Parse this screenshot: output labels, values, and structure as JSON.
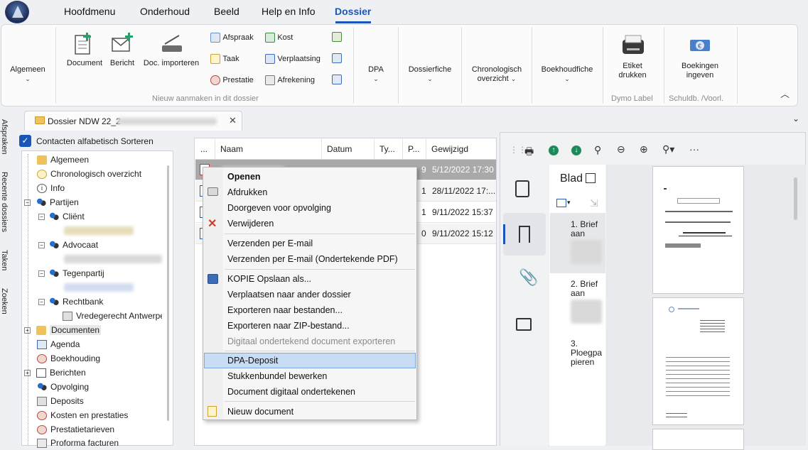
{
  "menubar": {
    "tabs": [
      "Hoofdmenu",
      "Onderhoud",
      "Beeld",
      "Help en Info",
      "Dossier"
    ],
    "active": "Dossier"
  },
  "ribbon": {
    "algemeen": "Algemeen",
    "document": "Document",
    "bericht": "Bericht",
    "doc_importeren": "Doc. importeren",
    "afspraak": "Afspraak",
    "taak": "Taak",
    "prestatie": "Prestatie",
    "kost": "Kost",
    "verplaatsing": "Verplaatsing",
    "afrekening": "Afrekening",
    "group_new": "Nieuw aanmaken in dit dossier",
    "dpa": "DPA",
    "dossierfiche": "Dossierfiche",
    "chrono_1": "Chronologisch",
    "chrono_2": "overzicht",
    "boekhoudfiche": "Boekhoudfiche",
    "etiket_1": "Etiket",
    "etiket_2": "drukken",
    "group_dymo": "Dymo Label",
    "boekingen_1": "Boekingen",
    "boekingen_2": "ingeven",
    "group_schuld": "Schuldb. /Voorl."
  },
  "doctab": {
    "title": "Dossier NDW 22_2 -"
  },
  "sidetabs": [
    "Afspraken",
    "Recente dossiers",
    "Taken",
    "Zoeken"
  ],
  "sort_label": "Contacten alfabetisch Sorteren",
  "tree": {
    "algemeen": "Algemeen",
    "chrono": "Chronologisch overzicht",
    "info": "Info",
    "partijen": "Partijen",
    "client": "Cliënt",
    "advocaat": "Advocaat",
    "tegenpartij": "Tegenpartij",
    "rechtbank": "Rechtbank",
    "vredegerecht": "Vredegerecht Antwerpen",
    "documenten": "Documenten",
    "agenda": "Agenda",
    "boekhouding": "Boekhouding",
    "berichten": "Berichten",
    "opvolging": "Opvolging",
    "deposits": "Deposits",
    "kosten": "Kosten en prestaties",
    "prestatietarieven": "Prestatietarieven",
    "proforma": "Proforma facturen"
  },
  "grid": {
    "headers": [
      "...",
      "Naam",
      "Datum",
      "Ty...",
      "P...",
      "Gewijzigd"
    ],
    "rows": [
      {
        "p": "9",
        "gewijzigd": "5/12/2022 17:30"
      },
      {
        "p": "1",
        "gewijzigd": "28/11/2022 17:..."
      },
      {
        "p": "1",
        "gewijzigd": "9/11/2022 15:37"
      },
      {
        "p": "0",
        "gewijzigd": "9/11/2022 15:12"
      }
    ]
  },
  "context_menu": {
    "openen": "Openen",
    "afdrukken": "Afdrukken",
    "doorgeven": "Doorgeven voor opvolging",
    "verwijderen": "Verwijderen",
    "email": "Verzenden per E-mail",
    "email_pdf": "Verzenden per E-mail (Ondertekende PDF)",
    "kopie": "KOPIE Opslaan als...",
    "verplaatsen": "Verplaatsen naar ander dossier",
    "exporteren": "Exporteren naar bestanden...",
    "zip": "Exporteren naar ZIP-bestand...",
    "digitaal_export": "Digitaal ondertekend document exporteren",
    "dpa_deposit": "DPA-Deposit",
    "stukkenbundel": "Stukkenbundel bewerken",
    "onderteken": "Document digitaal ondertekenen",
    "nieuw": "Nieuw document"
  },
  "preview": {
    "blad_title": "Blad",
    "items": [
      {
        "num": "1.",
        "label": "Brief aan"
      },
      {
        "num": "2.",
        "label": "Brief aan"
      },
      {
        "num": "3.",
        "label": "Ploegpa pieren"
      }
    ]
  }
}
